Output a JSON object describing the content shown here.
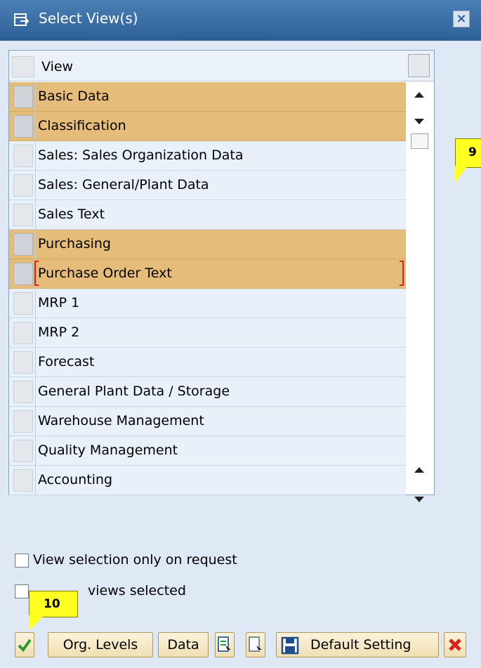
{
  "dialog": {
    "title": "Select View(s)",
    "close_label": "×"
  },
  "table": {
    "column_header": "View",
    "rows": [
      {
        "label": "Basic Data",
        "selected": true
      },
      {
        "label": "Classification",
        "selected": true
      },
      {
        "label": "Sales: Sales Organization Data",
        "selected": false
      },
      {
        "label": "Sales: General/Plant Data",
        "selected": false
      },
      {
        "label": "Sales Text",
        "selected": false
      },
      {
        "label": "Purchasing",
        "selected": true
      },
      {
        "label": "Purchase Order Text",
        "selected": true,
        "focused": true
      },
      {
        "label": "MRP 1",
        "selected": false
      },
      {
        "label": "MRP 2",
        "selected": false
      },
      {
        "label": "Forecast",
        "selected": false
      },
      {
        "label": "General Plant Data / Storage",
        "selected": false
      },
      {
        "label": "Warehouse Management",
        "selected": false
      },
      {
        "label": "Quality Management",
        "selected": false
      },
      {
        "label": "Accounting",
        "selected": false
      }
    ]
  },
  "callouts": {
    "nine": "9",
    "ten": "10"
  },
  "options": {
    "view_selection_label": "View selection only on request",
    "views_selected_label": "views selected"
  },
  "buttons": {
    "org_levels": "Org. Levels",
    "data": "Data",
    "default_setting": "Default Setting"
  },
  "colors": {
    "title_bar": "#2d5f96",
    "selected_row": "#e6bd78",
    "unselected_row": "#e8f1fa",
    "callout": "#ffff22"
  }
}
